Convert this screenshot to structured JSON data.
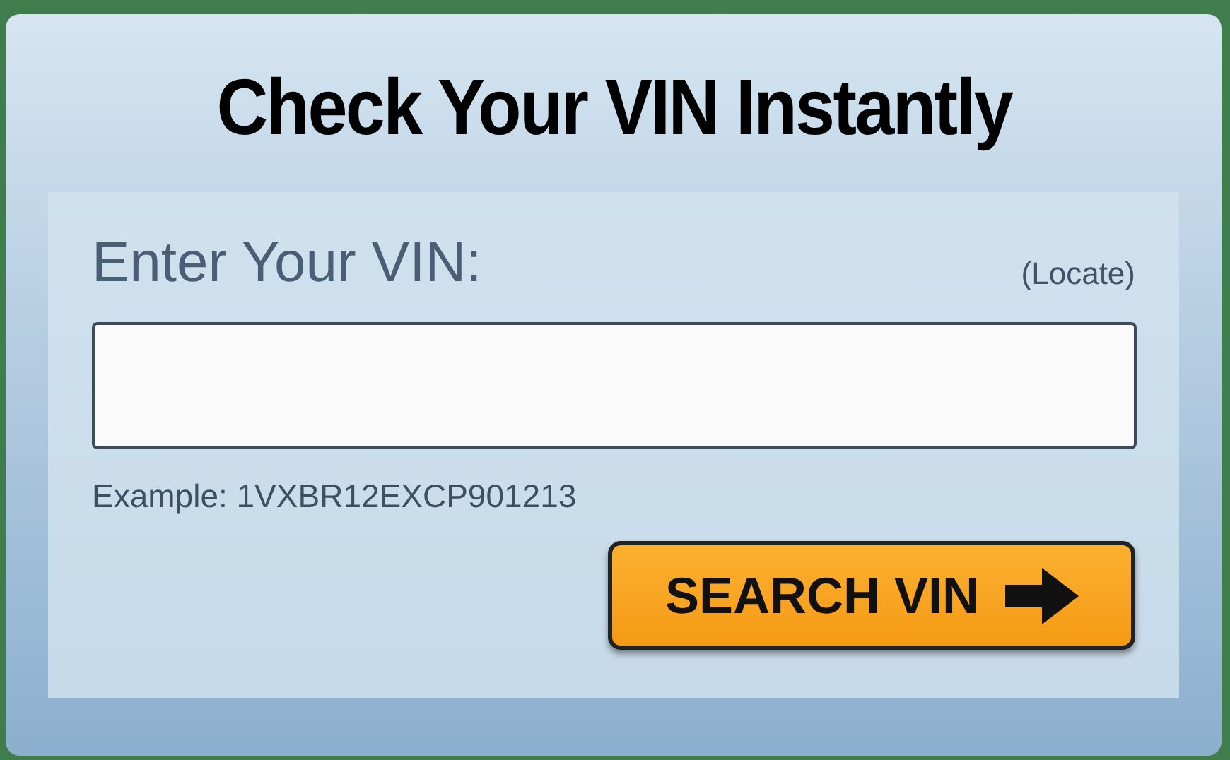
{
  "title": "Check Your VIN Instantly",
  "form": {
    "label": "Enter Your VIN:",
    "locate_link": "(Locate)",
    "example": "Example: 1VXBR12EXCP901213",
    "button": "SEARCH VIN"
  }
}
